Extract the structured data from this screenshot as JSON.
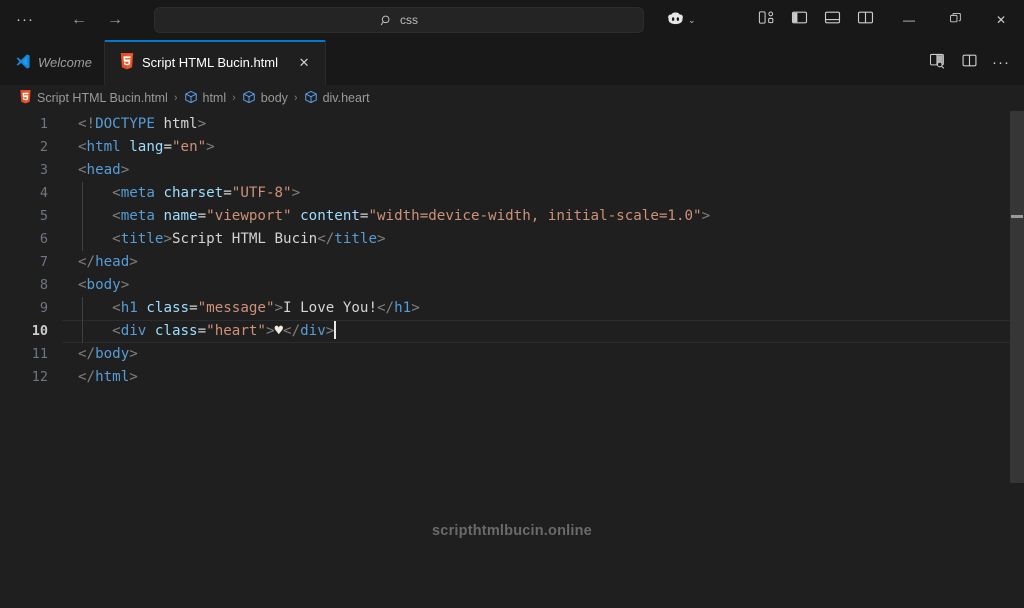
{
  "titlebar": {
    "menu_label": "···",
    "back_label": "←",
    "forward_label": "→",
    "search": {
      "value": "css",
      "placeholder": "Search"
    },
    "copilot_label": "Copilot",
    "chevron": "⌄",
    "minimize": "—",
    "restore": "❐",
    "close": "✕",
    "icons": {
      "menu": "more-ellipsis-icon",
      "back": "arrow-left-icon",
      "forward": "arrow-right-icon",
      "search": "search-icon",
      "copilot": "copilot-icon",
      "customize_layout": "customize-layout-icon",
      "toggle_primary_sidebar": "toggle-primary-sidebar-icon",
      "toggle_panel": "toggle-panel-icon",
      "toggle_secondary_sidebar": "toggle-secondary-sidebar-icon"
    }
  },
  "tabs": [
    {
      "label": "Welcome",
      "icon": "vscode-logo-icon",
      "active": false,
      "closable": false
    },
    {
      "label": "Script HTML Bucin.html",
      "icon": "html5-file-icon",
      "active": true,
      "closable": true,
      "close_label": "✕"
    }
  ],
  "tabbar_actions": {
    "split_with_search_label": "Open Changes",
    "split_editor_label": "Split Editor Right",
    "more_label": "···",
    "icons": {
      "split_search": "split-editor-search-icon",
      "split_editor": "split-editor-right-icon",
      "more": "more-ellipsis-icon"
    }
  },
  "breadcrumb": {
    "separator": "›",
    "items": [
      {
        "label": "Script HTML Bucin.html",
        "icon": "html5-file-icon"
      },
      {
        "label": "html",
        "icon": "symbol-cube-icon"
      },
      {
        "label": "body",
        "icon": "symbol-cube-icon"
      },
      {
        "label": "div.heart",
        "icon": "symbol-cube-icon"
      }
    ]
  },
  "editor": {
    "language": "html",
    "active_line": 10,
    "watermark": "scripthtmlbucin.online",
    "lines": [
      {
        "n": "1",
        "tokens": [
          {
            "t": "punct",
            "v": "<!"
          },
          {
            "t": "doctype",
            "v": "DOCTYPE"
          },
          {
            "t": "text",
            "v": " "
          },
          {
            "t": "text",
            "v": "html"
          },
          {
            "t": "punct",
            "v": ">"
          }
        ]
      },
      {
        "n": "2",
        "tokens": [
          {
            "t": "punct",
            "v": "<"
          },
          {
            "t": "tag",
            "v": "html"
          },
          {
            "t": "text",
            "v": " "
          },
          {
            "t": "attr",
            "v": "lang"
          },
          {
            "t": "eq",
            "v": "="
          },
          {
            "t": "str",
            "v": "\"en\""
          },
          {
            "t": "punct",
            "v": ">"
          }
        ]
      },
      {
        "n": "3",
        "tokens": [
          {
            "t": "punct",
            "v": "<"
          },
          {
            "t": "tag",
            "v": "head"
          },
          {
            "t": "punct",
            "v": ">"
          }
        ]
      },
      {
        "n": "4",
        "tokens": [
          {
            "t": "text",
            "v": "    "
          },
          {
            "t": "punct",
            "v": "<"
          },
          {
            "t": "tag",
            "v": "meta"
          },
          {
            "t": "text",
            "v": " "
          },
          {
            "t": "attr",
            "v": "charset"
          },
          {
            "t": "eq",
            "v": "="
          },
          {
            "t": "str",
            "v": "\"UTF-8\""
          },
          {
            "t": "punct",
            "v": ">"
          }
        ]
      },
      {
        "n": "5",
        "tokens": [
          {
            "t": "text",
            "v": "    "
          },
          {
            "t": "punct",
            "v": "<"
          },
          {
            "t": "tag",
            "v": "meta"
          },
          {
            "t": "text",
            "v": " "
          },
          {
            "t": "attr",
            "v": "name"
          },
          {
            "t": "eq",
            "v": "="
          },
          {
            "t": "str",
            "v": "\"viewport\""
          },
          {
            "t": "text",
            "v": " "
          },
          {
            "t": "attr",
            "v": "content"
          },
          {
            "t": "eq",
            "v": "="
          },
          {
            "t": "str",
            "v": "\"width=device-width, initial-scale=1.0\""
          },
          {
            "t": "punct",
            "v": ">"
          }
        ]
      },
      {
        "n": "6",
        "tokens": [
          {
            "t": "text",
            "v": "    "
          },
          {
            "t": "punct",
            "v": "<"
          },
          {
            "t": "tag",
            "v": "title"
          },
          {
            "t": "punct",
            "v": ">"
          },
          {
            "t": "text",
            "v": "Script HTML Bucin"
          },
          {
            "t": "punct",
            "v": "</"
          },
          {
            "t": "tag",
            "v": "title"
          },
          {
            "t": "punct",
            "v": ">"
          }
        ]
      },
      {
        "n": "7",
        "tokens": [
          {
            "t": "punct",
            "v": "</"
          },
          {
            "t": "tag",
            "v": "head"
          },
          {
            "t": "punct",
            "v": ">"
          }
        ]
      },
      {
        "n": "8",
        "tokens": [
          {
            "t": "punct",
            "v": "<"
          },
          {
            "t": "tag",
            "v": "body"
          },
          {
            "t": "punct",
            "v": ">"
          }
        ]
      },
      {
        "n": "9",
        "tokens": [
          {
            "t": "text",
            "v": "    "
          },
          {
            "t": "punct",
            "v": "<"
          },
          {
            "t": "tag",
            "v": "h1"
          },
          {
            "t": "text",
            "v": " "
          },
          {
            "t": "attr",
            "v": "class"
          },
          {
            "t": "eq",
            "v": "="
          },
          {
            "t": "str",
            "v": "\"message\""
          },
          {
            "t": "punct",
            "v": ">"
          },
          {
            "t": "text",
            "v": "I Love You!"
          },
          {
            "t": "punct",
            "v": "</"
          },
          {
            "t": "tag",
            "v": "h1"
          },
          {
            "t": "punct",
            "v": ">"
          }
        ]
      },
      {
        "n": "10",
        "tokens": [
          {
            "t": "text",
            "v": "    "
          },
          {
            "t": "punct",
            "v": "<"
          },
          {
            "t": "tag",
            "v": "div"
          },
          {
            "t": "text",
            "v": " "
          },
          {
            "t": "attr",
            "v": "class"
          },
          {
            "t": "eq",
            "v": "="
          },
          {
            "t": "str",
            "v": "\"heart\""
          },
          {
            "t": "punct",
            "v": ">"
          },
          {
            "t": "heart",
            "v": "♥"
          },
          {
            "t": "punct",
            "v": "</"
          },
          {
            "t": "tag",
            "v": "div"
          },
          {
            "t": "punct",
            "v": ">"
          },
          {
            "t": "cursor",
            "v": ""
          }
        ]
      },
      {
        "n": "11",
        "tokens": [
          {
            "t": "punct",
            "v": "</"
          },
          {
            "t": "tag",
            "v": "body"
          },
          {
            "t": "punct",
            "v": ">"
          }
        ]
      },
      {
        "n": "12",
        "tokens": [
          {
            "t": "punct",
            "v": "</"
          },
          {
            "t": "tag",
            "v": "html"
          },
          {
            "t": "punct",
            "v": ">"
          }
        ]
      }
    ]
  },
  "colors": {
    "titlebar_bg": "#181818",
    "editor_bg": "#1f1f1f",
    "active_tab_border": "#0078d4",
    "tag": "#569cd6",
    "attribute": "#9cdcfe",
    "string": "#ce9178",
    "punctuation": "#808080",
    "text": "#d4d4d4",
    "line_number": "#6e7681",
    "html5_icon": "#e44d26"
  }
}
